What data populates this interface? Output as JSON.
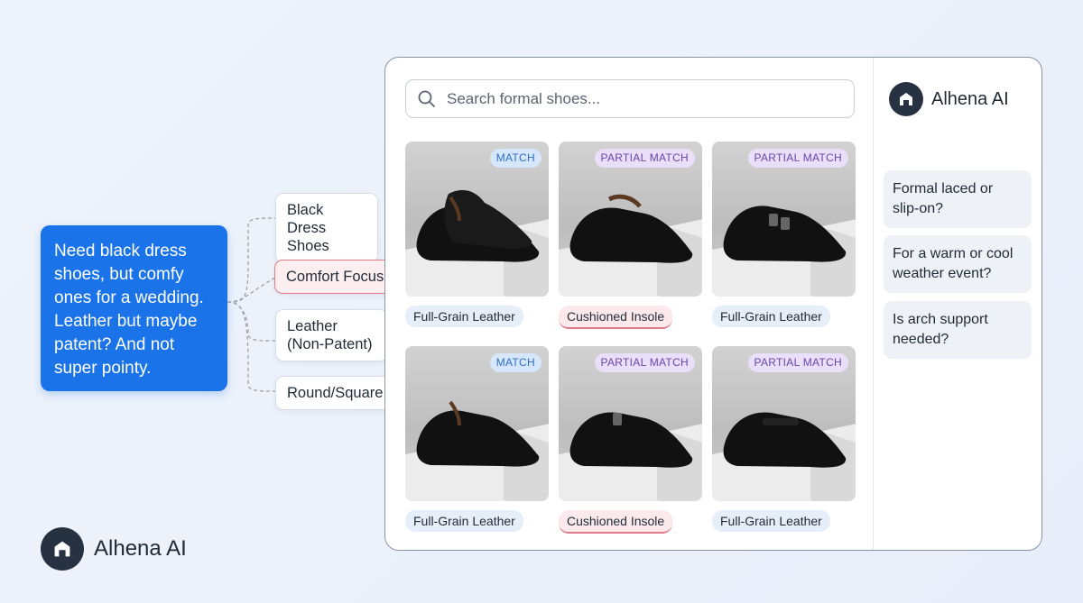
{
  "query": {
    "text": "Need black dress shoes, but comfy ones for a wedding. Leather but maybe patent? And not super pointy."
  },
  "chips": [
    {
      "label": "Black Dress Shoes"
    },
    {
      "label": "Comfort Focus"
    },
    {
      "label": "Leather (Non-Patent)"
    },
    {
      "label": "Round/Square Toe"
    }
  ],
  "search": {
    "placeholder": "Search formal shoes..."
  },
  "products": [
    {
      "badge": "MATCH",
      "tag": "Full-Grain Leather"
    },
    {
      "badge": "PARTIAL MATCH",
      "tag": "Cushioned Insole"
    },
    {
      "badge": "PARTIAL MATCH",
      "tag": "Full-Grain Leather"
    },
    {
      "badge": "MATCH",
      "tag": "Full-Grain Leather"
    },
    {
      "badge": "PARTIAL MATCH",
      "tag": "Cushioned Insole"
    },
    {
      "badge": "PARTIAL MATCH",
      "tag": "Full-Grain Leather"
    }
  ],
  "assistant": {
    "name": "Alhena AI",
    "suggestions": [
      "Formal laced or slip-on?",
      "For a warm or cool weather event?",
      "Is arch support needed?"
    ]
  },
  "footer_brand": {
    "name": "Alhena AI"
  },
  "colors": {
    "accent": "#1a73e8",
    "match": "#2f6fc4",
    "partial": "#6b46a8",
    "focus": "#e07a88"
  },
  "icons": [
    "search-icon",
    "alhena-logo-icon",
    "shoe-image"
  ]
}
